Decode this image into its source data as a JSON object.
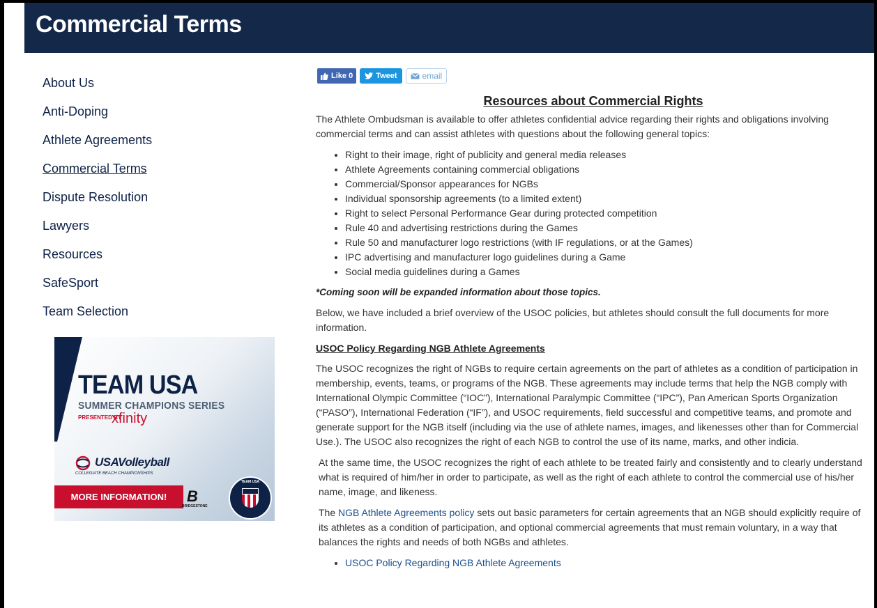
{
  "header": {
    "title": "Commercial Terms"
  },
  "sidebar": {
    "items": [
      {
        "label": "About Us"
      },
      {
        "label": "Anti-Doping"
      },
      {
        "label": "Athlete Agreements"
      },
      {
        "label": "Commercial Terms"
      },
      {
        "label": "Dispute Resolution"
      },
      {
        "label": "Lawyers"
      },
      {
        "label": "Resources"
      },
      {
        "label": "SafeSport"
      },
      {
        "label": "Team Selection"
      }
    ]
  },
  "ad": {
    "title": "TEAM USA",
    "subtitle": "SUMMER CHAMPIONS SERIES",
    "presented_by": "PRESENTED BY",
    "sponsor": "xfinity",
    "partner": "USAVolleyball",
    "partner_sub": "COLLEGIATE BEACH CHAMPIONSHIPS",
    "cta": "MORE INFORMATION!",
    "bridgestone": "BRIDGESTONE",
    "seal_text": "TEAM USA"
  },
  "social": {
    "like": "Like 0",
    "tweet": "Tweet",
    "email": "email"
  },
  "main": {
    "heading": "Resources about Commercial Rights",
    "intro": "The Athlete Ombudsman is available to offer athletes confidential advice regarding their rights and obligations involving commercial terms and can assist athletes with questions about the following general topics:",
    "topics": [
      "Right to their image, right of publicity and general media releases",
      "Athlete Agreements containing commercial obligations",
      "Commercial/Sponsor appearances for NGBs",
      "Individual sponsorship agreements (to a limited extent)",
      "Right to select Personal Performance Gear during protected competition",
      "Rule 40 and advertising restrictions during the Games",
      "Rule 50 and manufacturer logo restrictions (with IF regulations, or at the Games)",
      "IPC advertising and manufacturer logo guidelines during a Game",
      "Social media guidelines during a Games"
    ],
    "coming_soon": "*Coming soon will be expanded information about those topics.",
    "below": "Below, we have included a brief overview of the USOC policies, but athletes should consult the full documents for more information.",
    "section_title": "USOC Policy Regarding NGB Athlete Agreements",
    "para1": "The USOC recognizes the right of NGBs to require certain agreements on the part of athletes as a condition of participation in membership, events, teams, or programs of the NGB. These agreements may include terms that help the NGB comply with International Olympic Committee (“IOC”), International Paralympic Committee (“IPC”), Pan American Sports Organization (“PASO”), International Federation (“IF”), and USOC requirements, field successful and competitive teams, and promote and generate support for the NGB itself (including via the use of athlete names, images, and likenesses other than for Commercial Use.). The USOC also recognizes the right of each NGB to control the use of its name, marks, and other indicia.",
    "para2": "At the same time, the USOC recognizes the right of each athlete to be treated fairly and consistently and to clearly understand what is required of him/her in order to participate, as well as the right of each athlete to control the commercial use of his/her name, image, and likeness.",
    "para3_pre": "The ",
    "para3_link": "NGB Athlete Agreements policy",
    "para3_post": " sets out basic parameters for certain agreements that an NGB should explicitly require of its athletes as a condition of participation, and optional commercial agreements that must remain voluntary, in a way that balances the rights and needs of both NGBs and athletes.",
    "links": [
      "USOC Policy Regarding NGB Athlete Agreements"
    ]
  }
}
